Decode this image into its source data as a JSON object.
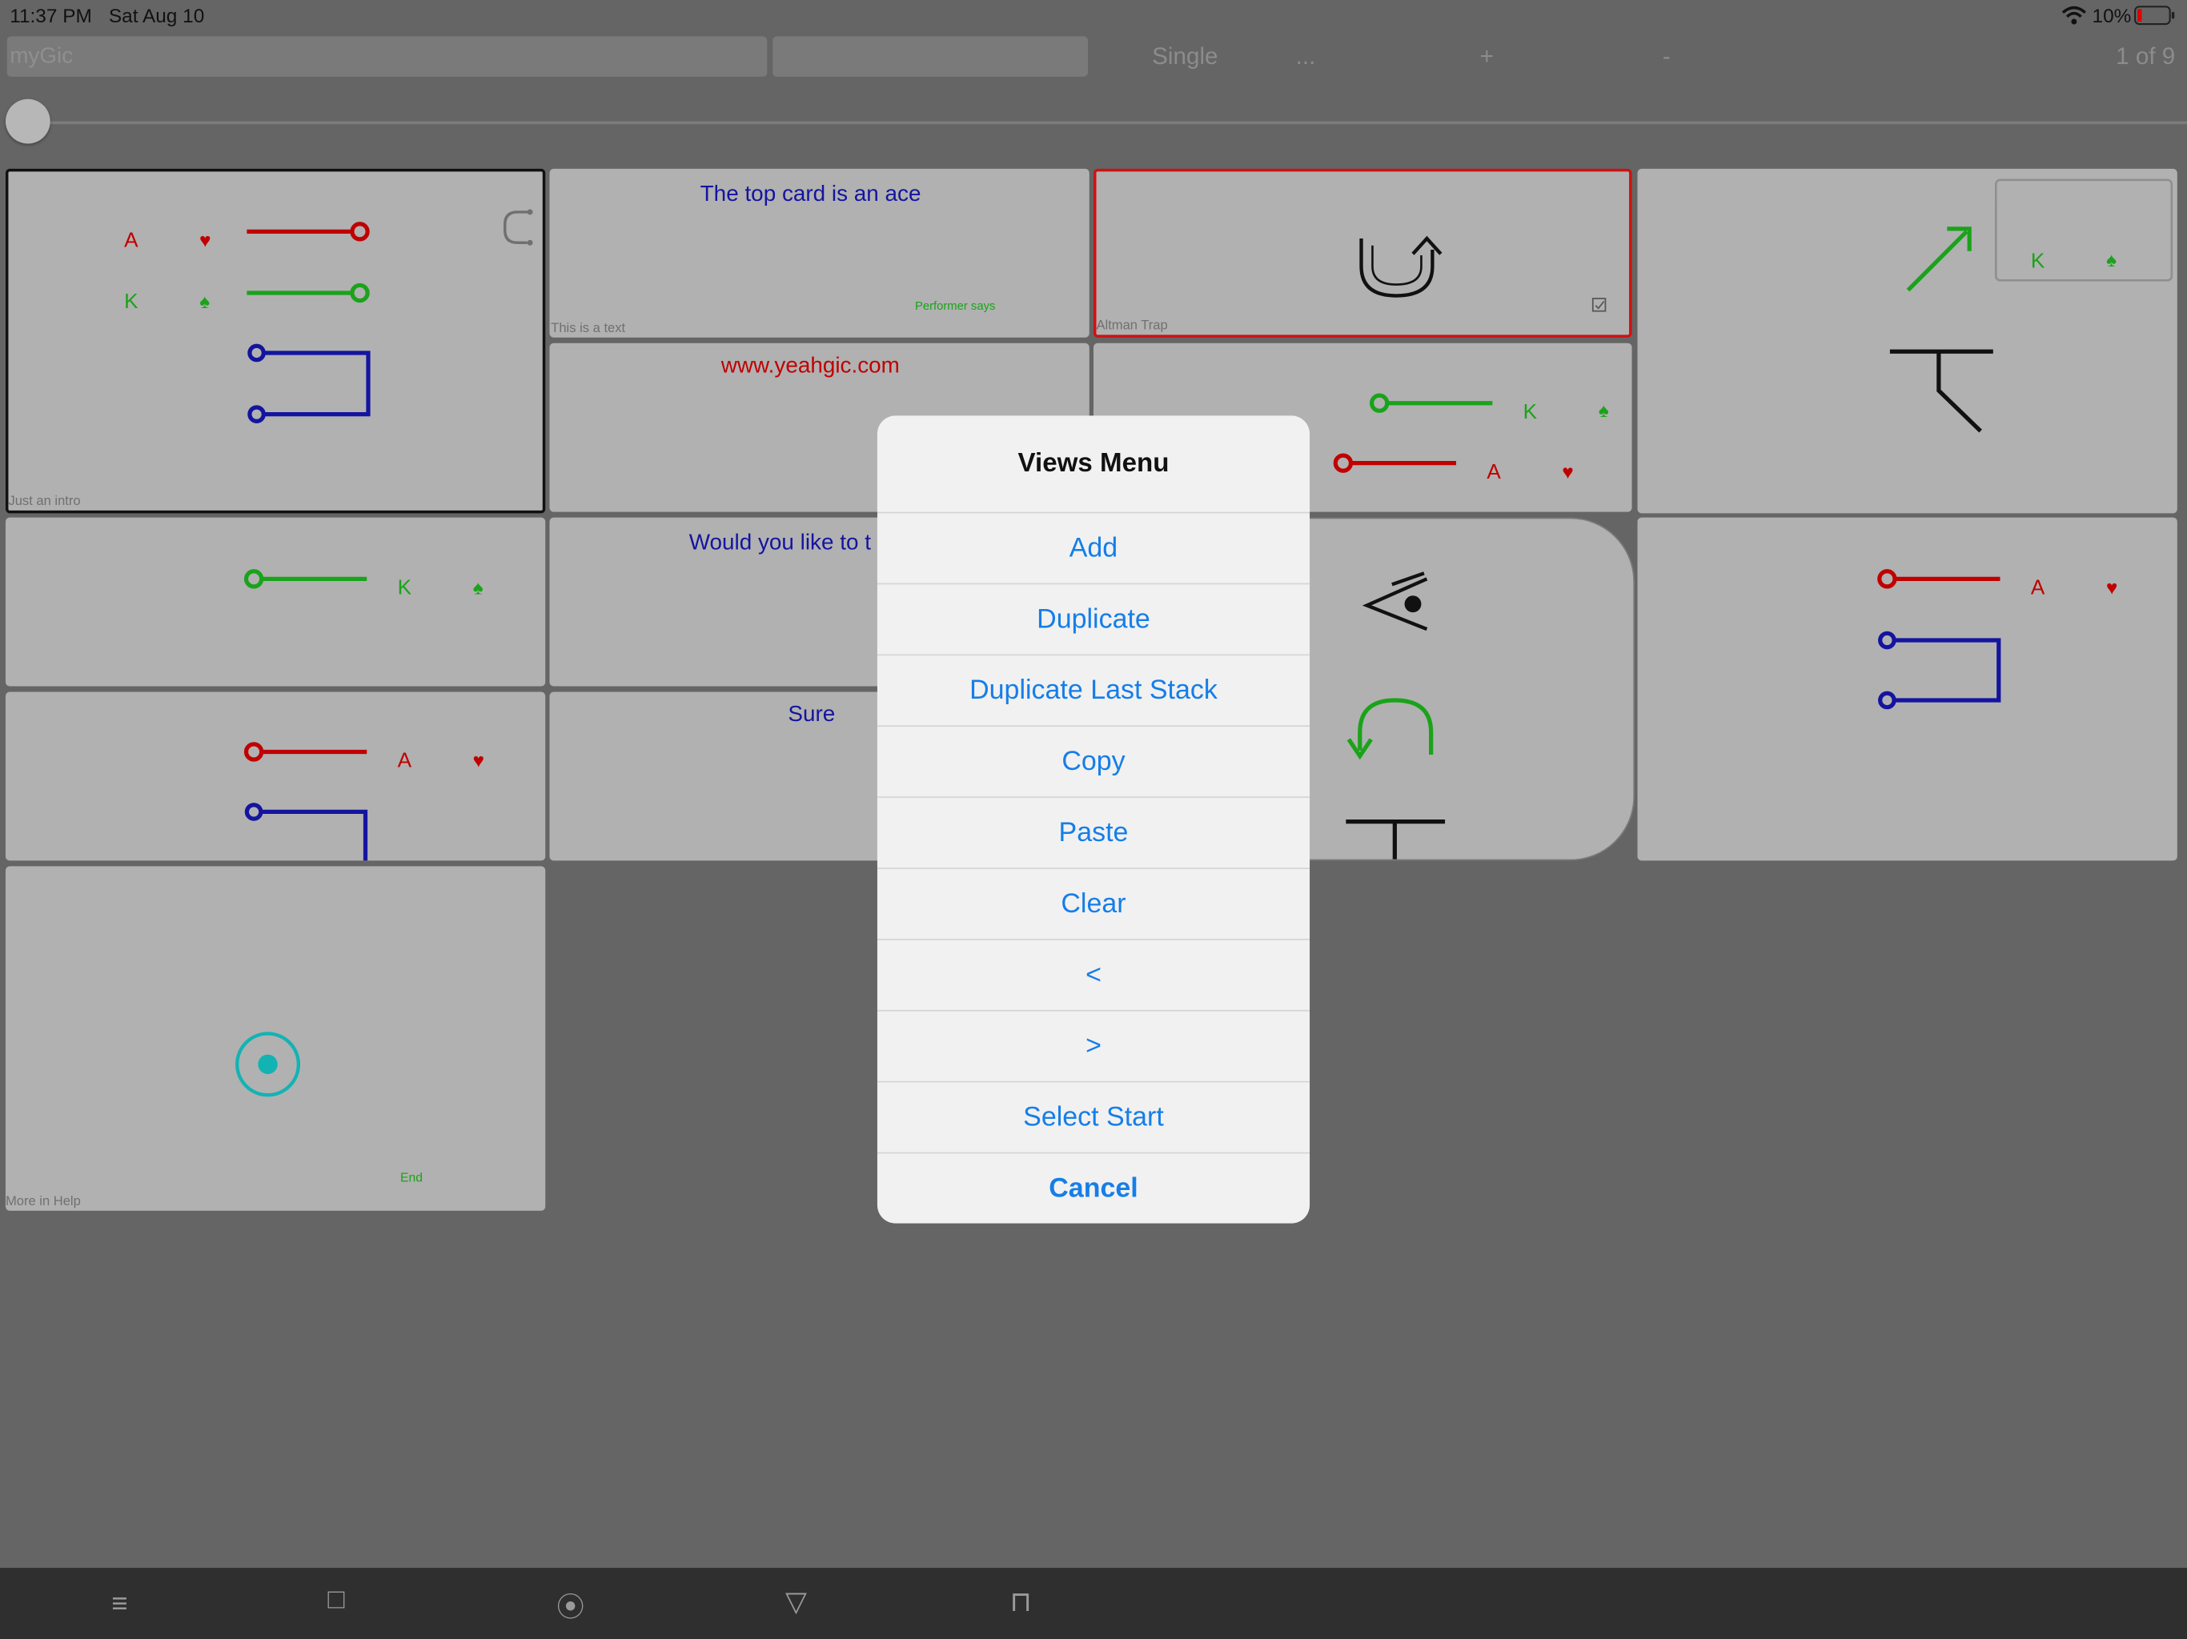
{
  "status_bar": {
    "time": "11:37 PM",
    "date": "Sat Aug 10",
    "battery": "10%"
  },
  "toolbar": {
    "name_value": "myGic",
    "second_value": "",
    "mode_label": "Single",
    "more_label": "...",
    "plus_label": "+",
    "minus_label": "-",
    "page_counter": "1 of 9",
    "slider_value": 0
  },
  "cards": {
    "intro": {
      "caption": "Just an intro",
      "rank_a": "A",
      "rank_k": "K",
      "heart": "♥",
      "spade": "♠"
    },
    "text_card": {
      "title": "The top card is an ace",
      "subtitle": "Performer says",
      "caption": "This is a text"
    },
    "trap_card": {
      "caption": "Altman Trap"
    },
    "right_top": {
      "rank_k": "K",
      "spade": "♠"
    },
    "url_card": {
      "title": "www.yeahgic.com"
    },
    "middle_row": {
      "rank_k": "K",
      "spade": "♠",
      "rank_a": "A",
      "heart": "♥"
    },
    "left_k": {
      "rank_k": "K",
      "spade": "♠"
    },
    "question_card": {
      "title": "Would you like to t"
    },
    "right_mid": {
      "rank_a": "A",
      "heart": "♥"
    },
    "left_a": {
      "rank_a": "A",
      "heart": "♥"
    },
    "sure_card": {
      "title": "Sure"
    },
    "end_card": {
      "label": "End",
      "caption": "More in Help"
    }
  },
  "dialog": {
    "title": "Views Menu",
    "items": [
      "Add",
      "Duplicate",
      "Duplicate Last Stack",
      "Copy",
      "Paste",
      "Clear",
      "<",
      ">",
      "Select Start"
    ],
    "cancel": "Cancel"
  },
  "navbar": {
    "icons": [
      "≡",
      "□",
      "⦿",
      "▽",
      "⊓"
    ]
  },
  "colors": {
    "accent": "#157ee8",
    "red": "#c00000",
    "green": "#1aa31a",
    "blue": "#1414a0",
    "teal": "#13b3b3"
  }
}
